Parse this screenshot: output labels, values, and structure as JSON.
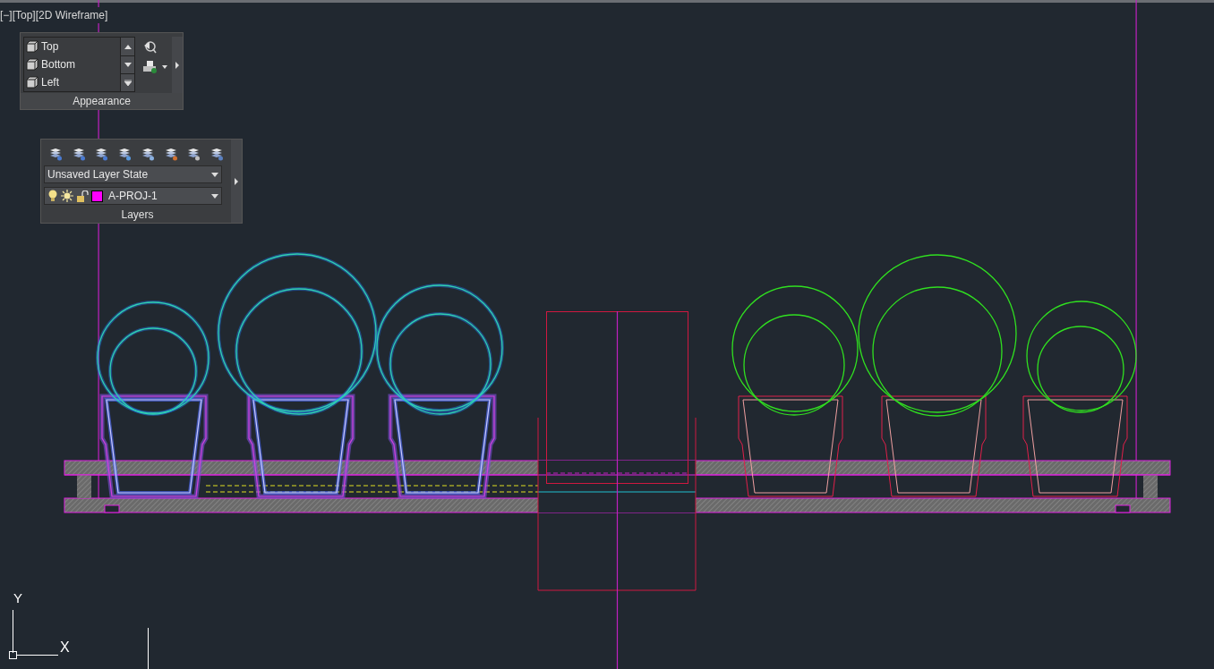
{
  "viewport": {
    "label": "[−][Top][2D Wireframe]"
  },
  "appearance_panel": {
    "title": "Appearance",
    "views": [
      {
        "label": "Top"
      },
      {
        "label": "Bottom"
      },
      {
        "label": "Left"
      }
    ]
  },
  "layers_panel": {
    "title": "Layers",
    "layer_state": "Unsaved Layer State",
    "current_layer": {
      "name": "A-PROJ-1",
      "color": "#ff00ff"
    }
  },
  "ucs": {
    "x_label": "X",
    "y_label": "Y"
  }
}
